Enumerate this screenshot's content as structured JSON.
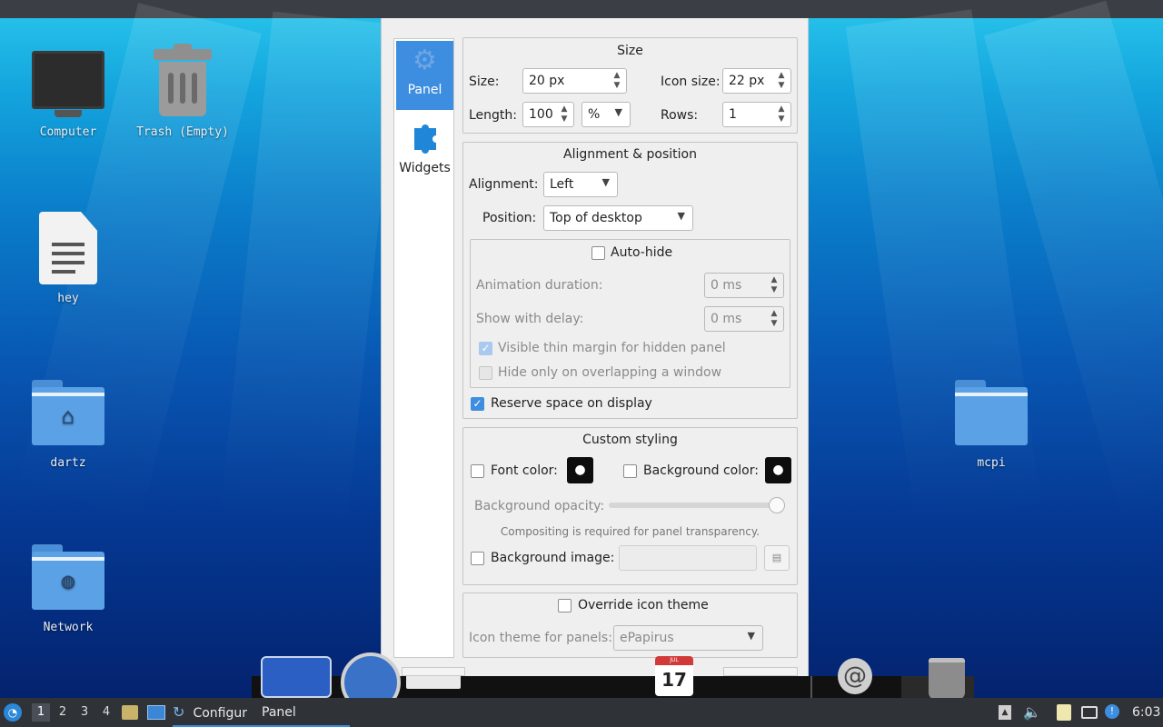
{
  "desktop": {
    "icons": [
      {
        "label": "Computer"
      },
      {
        "label": "Trash (Empty)"
      },
      {
        "label": "hey"
      },
      {
        "label": "dartz"
      },
      {
        "label": "Network"
      },
      {
        "label": "mcpi"
      }
    ]
  },
  "dialog": {
    "nav": [
      {
        "label": "Panel",
        "icon": "gear-icon",
        "active": true
      },
      {
        "label": "Widgets",
        "icon": "puzzle-icon",
        "active": false
      }
    ],
    "size": {
      "title": "Size",
      "size_label": "Size:",
      "size_value": "20 px",
      "icon_size_label": "Icon size:",
      "icon_size_value": "22 px",
      "length_label": "Length:",
      "length_value": "100",
      "length_unit": "%",
      "rows_label": "Rows:",
      "rows_value": "1"
    },
    "alignment": {
      "title": "Alignment & position",
      "alignment_label": "Alignment:",
      "alignment_value": "Left",
      "position_label": "Position:",
      "position_value": "Top of desktop",
      "autohide_label": "Auto-hide",
      "autohide_checked": false,
      "anim_label": "Animation duration:",
      "anim_value": "0 ms",
      "delay_label": "Show with delay:",
      "delay_value": "0 ms",
      "thin_margin_label": "Visible thin margin for hidden panel",
      "thin_margin_checked": true,
      "hide_overlap_label": "Hide only on overlapping a window",
      "hide_overlap_checked": false,
      "reserve_label": "Reserve space on display",
      "reserve_checked": true
    },
    "styling": {
      "title": "Custom styling",
      "font_color_label": "Font color:",
      "bg_color_label": "Background color:",
      "opacity_label": "Background opacity:",
      "opacity_level": 1.0,
      "note": "Compositing is required for panel transparency.",
      "bg_image_label": "Background image:"
    },
    "icon_theme": {
      "override_label": "Override icon theme",
      "theme_label": "Icon theme for panels:",
      "theme_value": "ePapirus"
    }
  },
  "taskbar": {
    "workspaces": [
      "1",
      "2",
      "3",
      "4"
    ],
    "active_workspace": "1",
    "task_label": "Configur",
    "task_label_2": "Panel",
    "calendar_month": "JUL",
    "calendar_day": "17",
    "clock": "6:03"
  },
  "colors": {
    "accent": "#3d8ee0",
    "taskbar": "#2f3338"
  }
}
